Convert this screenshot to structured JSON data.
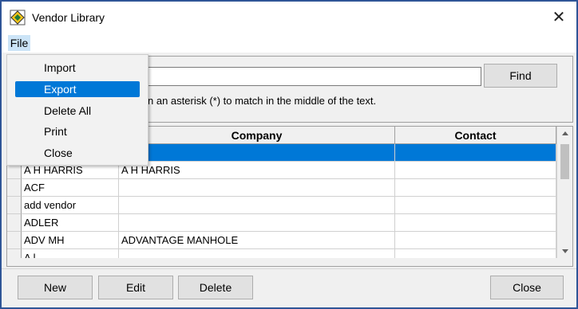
{
  "window": {
    "title": "Vendor Library",
    "icon": "vendor-library-app-icon",
    "close_glyph": "✕"
  },
  "menubar": {
    "file_label": "File"
  },
  "file_menu": {
    "items": [
      {
        "label": "Import",
        "highlighted": false
      },
      {
        "label": "Export",
        "highlighted": true
      },
      {
        "label": "Delete All",
        "highlighted": false
      },
      {
        "label": "Print",
        "highlighted": false
      },
      {
        "label": "Close",
        "highlighted": false
      }
    ]
  },
  "search": {
    "value": "",
    "find_label": "Find",
    "hint_visible": "n an asterisk (*) to match in the middle of the text."
  },
  "table": {
    "columns": [
      "",
      "Company",
      "Contact"
    ],
    "selected_row": 0,
    "rows": [
      {
        "name": "",
        "company": "",
        "contact": ""
      },
      {
        "name": "A H HARRIS",
        "company": "A H HARRIS",
        "contact": ""
      },
      {
        "name": "ACF",
        "company": "",
        "contact": ""
      },
      {
        "name": "add vendor",
        "company": "",
        "contact": ""
      },
      {
        "name": "ADLER",
        "company": "",
        "contact": ""
      },
      {
        "name": "ADV MH",
        "company": "ADVANTAGE MANHOLE",
        "contact": ""
      },
      {
        "name": "A l",
        "company": "",
        "contact": ""
      }
    ]
  },
  "buttons": {
    "new": "New",
    "edit": "Edit",
    "delete": "Delete",
    "close": "Close"
  },
  "colors": {
    "selection": "#0078d7",
    "window_border": "#2f5597"
  }
}
